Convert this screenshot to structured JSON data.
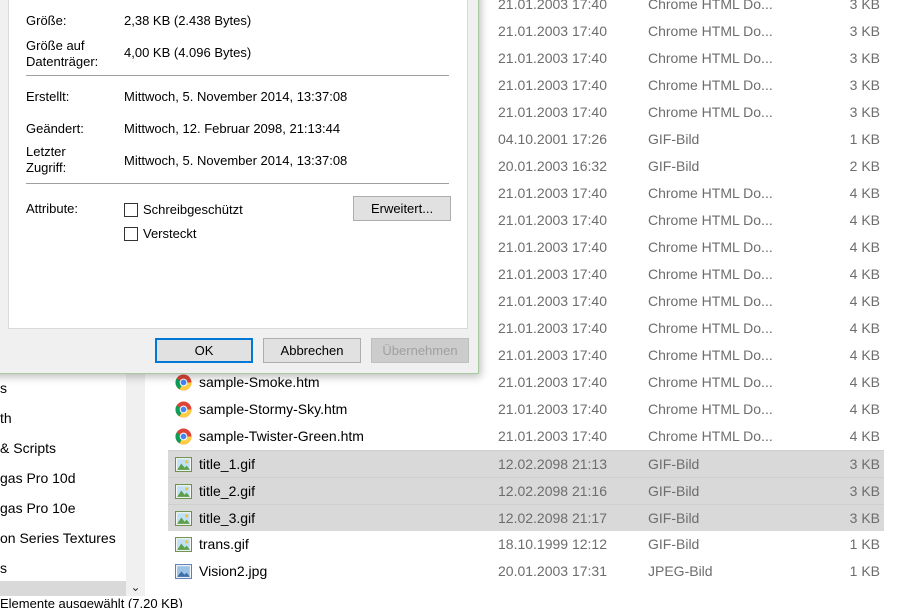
{
  "dialog": {
    "size_label": "Größe:",
    "size_value": "2,38 KB (2.438 Bytes)",
    "disk_size_label_1": "Größe auf",
    "disk_size_label_2": "Datenträger:",
    "disk_size_value": "4,00 KB (4.096 Bytes)",
    "created_label": "Erstellt:",
    "created_value": "Mittwoch, 5. November 2014, 13:37:08",
    "modified_label": "Geändert:",
    "modified_value": "Mittwoch, 12. Februar 2098, 21:13:44",
    "accessed_label_1": "Letzter",
    "accessed_label_2": "Zugriff:",
    "accessed_value": "Mittwoch, 5. November 2014, 13:37:08",
    "attributes_label": "Attribute:",
    "readonly_label": "Schreibgeschützt",
    "hidden_label": "Versteckt",
    "advanced_button": "Erweitert...",
    "ok_button": "OK",
    "cancel_button": "Abbrechen",
    "apply_button": "Übernehmen"
  },
  "nav": {
    "items": [
      "s",
      "th",
      "& Scripts",
      "gas Pro 10d",
      "gas Pro 10e",
      "on Series Textures",
      "s"
    ]
  },
  "files": [
    {
      "name": "",
      "date": "21.01.2003 17:40",
      "type": "Chrome HTML Do...",
      "size": "3 KB",
      "icon": "chrome",
      "selected": false
    },
    {
      "name": "",
      "date": "21.01.2003 17:40",
      "type": "Chrome HTML Do...",
      "size": "3 KB",
      "icon": "chrome",
      "selected": false
    },
    {
      "name": "",
      "date": "21.01.2003 17:40",
      "type": "Chrome HTML Do...",
      "size": "3 KB",
      "icon": "chrome",
      "selected": false
    },
    {
      "name": "",
      "date": "21.01.2003 17:40",
      "type": "Chrome HTML Do...",
      "size": "3 KB",
      "icon": "chrome",
      "selected": false
    },
    {
      "name": "",
      "date": "21.01.2003 17:40",
      "type": "Chrome HTML Do...",
      "size": "3 KB",
      "icon": "chrome",
      "selected": false
    },
    {
      "name": "",
      "date": "04.10.2001 17:26",
      "type": "GIF-Bild",
      "size": "1 KB",
      "icon": "gif",
      "selected": false
    },
    {
      "name": "",
      "date": "20.01.2003 16:32",
      "type": "GIF-Bild",
      "size": "2 KB",
      "icon": "gif",
      "selected": false
    },
    {
      "name": "",
      "date": "21.01.2003 17:40",
      "type": "Chrome HTML Do...",
      "size": "4 KB",
      "icon": "chrome",
      "selected": false
    },
    {
      "name": "",
      "date": "21.01.2003 17:40",
      "type": "Chrome HTML Do...",
      "size": "4 KB",
      "icon": "chrome",
      "selected": false
    },
    {
      "name": "",
      "date": "21.01.2003 17:40",
      "type": "Chrome HTML Do...",
      "size": "4 KB",
      "icon": "chrome",
      "selected": false
    },
    {
      "name": "",
      "date": "21.01.2003 17:40",
      "type": "Chrome HTML Do...",
      "size": "4 KB",
      "icon": "chrome",
      "selected": false
    },
    {
      "name": "",
      "date": "21.01.2003 17:40",
      "type": "Chrome HTML Do...",
      "size": "4 KB",
      "icon": "chrome",
      "selected": false
    },
    {
      "name": "",
      "date": "21.01.2003 17:40",
      "type": "Chrome HTML Do...",
      "size": "4 KB",
      "icon": "chrome",
      "selected": false
    },
    {
      "name": "",
      "date": "21.01.2003 17:40",
      "type": "Chrome HTML Do...",
      "size": "4 KB",
      "icon": "chrome",
      "selected": false
    },
    {
      "name": "sample-Smoke.htm",
      "date": "21.01.2003 17:40",
      "type": "Chrome HTML Do...",
      "size": "4 KB",
      "icon": "chrome",
      "selected": false
    },
    {
      "name": "sample-Stormy-Sky.htm",
      "date": "21.01.2003 17:40",
      "type": "Chrome HTML Do...",
      "size": "4 KB",
      "icon": "chrome",
      "selected": false
    },
    {
      "name": "sample-Twister-Green.htm",
      "date": "21.01.2003 17:40",
      "type": "Chrome HTML Do...",
      "size": "4 KB",
      "icon": "chrome",
      "selected": false
    },
    {
      "name": "title_1.gif",
      "date": "12.02.2098 21:13",
      "type": "GIF-Bild",
      "size": "3 KB",
      "icon": "gif",
      "selected": true
    },
    {
      "name": "title_2.gif",
      "date": "12.02.2098 21:16",
      "type": "GIF-Bild",
      "size": "3 KB",
      "icon": "gif",
      "selected": true
    },
    {
      "name": "title_3.gif",
      "date": "12.02.2098 21:17",
      "type": "GIF-Bild",
      "size": "3 KB",
      "icon": "gif",
      "selected": true
    },
    {
      "name": "trans.gif",
      "date": "18.10.1999 12:12",
      "type": "GIF-Bild",
      "size": "1 KB",
      "icon": "gif",
      "selected": false
    },
    {
      "name": "Vision2.jpg",
      "date": "20.01.2003 17:31",
      "type": "JPEG-Bild",
      "size": "1 KB",
      "icon": "jpeg",
      "selected": false
    }
  ],
  "status": {
    "text": "Elemente ausgewählt (7,20 KB)"
  },
  "colors": {
    "selection": "#d9d9d9",
    "dialog_bg": "#f0f0f0",
    "accent": "#0078d7"
  }
}
